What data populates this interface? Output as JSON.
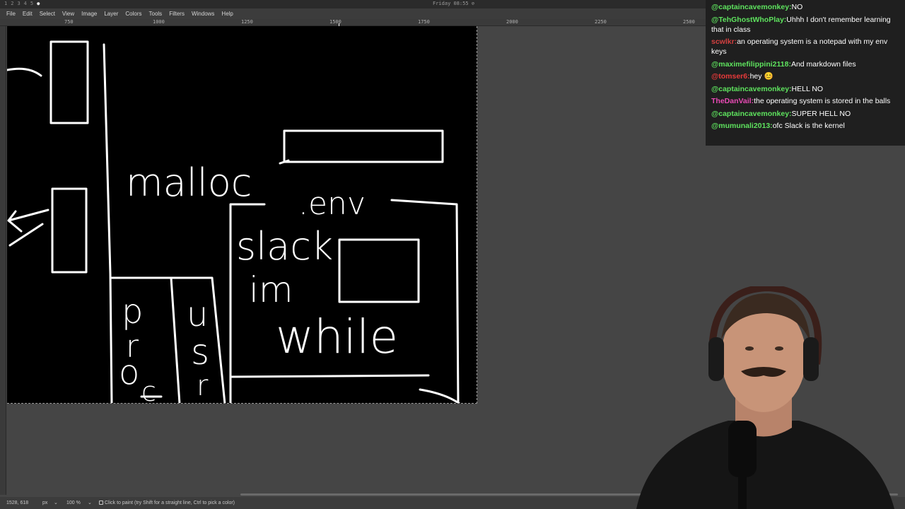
{
  "system": {
    "workspaces": [
      "1",
      "2",
      "3",
      "4",
      "5",
      "●"
    ],
    "clock": "Friday 08:55 ⊘"
  },
  "menubar": [
    "File",
    "Edit",
    "Select",
    "View",
    "Image",
    "Layer",
    "Colors",
    "Tools",
    "Filters",
    "Windows",
    "Help"
  ],
  "ruler": {
    "ticks": [
      "750",
      "1000",
      "1250",
      "1500",
      "1750",
      "2000",
      "2250",
      "2500"
    ]
  },
  "canvas_text": {
    "malloc": "malloc",
    "env": ".env",
    "slack": "slack",
    "im": "im",
    "while": "while",
    "proc_p": "p",
    "proc_r": "r",
    "proc_o": "o",
    "proc_c": "c",
    "usr_u": "u",
    "usr_s": "s",
    "usr_r": "r"
  },
  "status": {
    "coords": "1528, 618",
    "unit": "px",
    "zoom": "100 %",
    "message": "Click to paint (try Shift for a straight line, Ctrl to pick a color)"
  },
  "chat": [
    {
      "user": "@captaincavemonkey:",
      "text": "NO",
      "color": "#5ee35e"
    },
    {
      "user": "@TehGhostWhoPlay:",
      "text": "Uhhh I don't remember learning that in class",
      "color": "#5ee35e"
    },
    {
      "user": "scwlkr:",
      "text": "an operating system is a notepad with my env keys",
      "color": "#d24040"
    },
    {
      "user": "@maximefilippini2118:",
      "text": "And markdown files",
      "color": "#5ee35e"
    },
    {
      "user": "@tomser6:",
      "text": "hey 😊",
      "color": "#e83a3a"
    },
    {
      "user": "@captaincavemonkey:",
      "text": "HELL NO",
      "color": "#5ee35e"
    },
    {
      "user": "TheDanVail:",
      "text": "the operating system is stored in the balls",
      "color": "#e94bb5"
    },
    {
      "user": "@captaincavemonkey:",
      "text": "SUPER HELL NO",
      "color": "#5ee35e"
    },
    {
      "user": "@mumunali2013:",
      "text": "ofc Slack is the kernel",
      "color": "#5ee35e"
    }
  ],
  "colors": {
    "canvas": "#000000",
    "chrome": "#3c3c3c",
    "workspace": "#454545",
    "stroke": "#ffffff"
  }
}
